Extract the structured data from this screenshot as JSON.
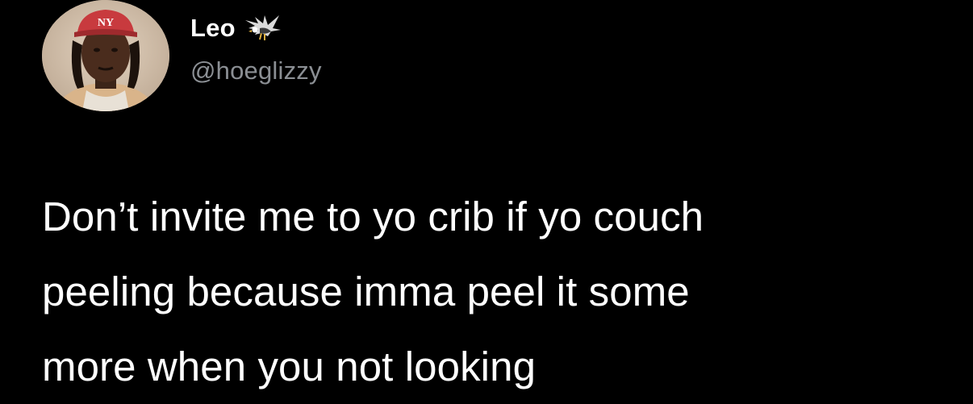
{
  "tweet": {
    "display_name": "Leo",
    "name_emoji_icon": "eagle-icon",
    "handle": "@hoeglizzy",
    "text": "Don’t invite me to yo crib if yo couch\npeeling because imma peel it some\nmore when you not looking"
  },
  "colors": {
    "background": "#000000",
    "primary_text": "#ffffff",
    "secondary_text": "#8b8f94"
  }
}
